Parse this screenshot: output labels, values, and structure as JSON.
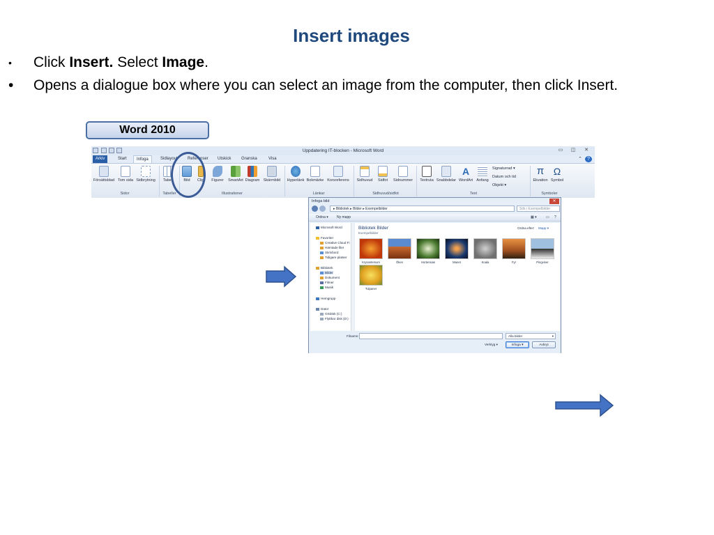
{
  "slide": {
    "title": "Insert images",
    "bullet1": {
      "pre": "Click ",
      "b1": "Insert.",
      "mid": " Select ",
      "b2": "Image",
      "post": "."
    },
    "bullet2": "Opens a dialogue box where you can select an image from the computer, then click Insert.",
    "bullet_glyph": "•",
    "badge": "Word 2010"
  },
  "word": {
    "window_title": "Uppdatering IT-blocken  -  Microsoft Word",
    "window_controls": [
      "▭",
      "◫",
      "✕"
    ],
    "tabs": [
      "Arkiv",
      "Start",
      "Infoga",
      "Sidlayout",
      "Referenser",
      "Utskick",
      "Granska",
      "Visa"
    ],
    "active_tab": "Infoga",
    "buttons": {
      "cover": "Försättsblad",
      "blank": "Tom sida",
      "page_break": "Sidbrytning",
      "table": "Tabell",
      "picture": "Bild",
      "clip": "ClipArt",
      "shapes": "Figurer",
      "smartart": "SmartArt",
      "chart": "Diagram",
      "screenshot": "Skärmbild",
      "hyperlink": "Hyperlänk",
      "bookmark": "Bokmärke",
      "crossref": "Korsreferens",
      "header": "Sidhuvud",
      "footer": "Sidfot",
      "pagenum": "Sidnummer",
      "textbox": "Textruta",
      "quickparts": "Snabbdelar",
      "wordart": "WordArt",
      "dropcap": "Anfang",
      "signature": "Signaturrad",
      "datetime": "Datum och tid",
      "object": "Objekt",
      "equation": "Ekvation",
      "symbol": "Symbol"
    },
    "groups": {
      "pages": "Sidor",
      "tables": "Tabeller",
      "illustrations": "Illustrationer",
      "links": "Länkar",
      "headerfooter": "Sidhuvud/sidfot",
      "text": "Text",
      "symbols": "Symboler"
    }
  },
  "dialog": {
    "title": "Infoga bild",
    "close": "✕",
    "address": "▸ Bibliotek ▸ Bilder ▸ Exempelbilder",
    "search_placeholder": "Sök i Exempelbilder",
    "toolbar": {
      "organize": "Ordna ▾",
      "new_folder": "Ny mapp"
    },
    "nav": {
      "word": "Microsoft Word",
      "favorites": "Favoriter",
      "fav_items": [
        "Creative Cloud Fi",
        "Hämtade filer",
        "Skrivbord",
        "Tidigare platser"
      ],
      "libraries": "Bibliotek",
      "lib_items": [
        "Bilder",
        "Dokument",
        "Filmer",
        "Musik"
      ],
      "homegroup": "Hemgrupp",
      "computer": "Dator",
      "drives": [
        "OSDisk (C:)",
        "Flyttbar disk (D:)"
      ]
    },
    "library_title": "Bibliotek Bilder",
    "library_sub": "Exempelbilder",
    "arrange": "Ordna efter:",
    "arrange_value": "Mapp ▾",
    "images": [
      "Krysantemum",
      "Öken",
      "Hortensias",
      "Manet",
      "Koala",
      "Fyr",
      "Pingviner",
      "Tulpaner"
    ],
    "filename_label": "Filnamn:",
    "filter": "Alla bilder",
    "tools": "Verktyg",
    "insert_btn": "Infoga",
    "cancel_btn": "Avbryt"
  },
  "colors": {
    "title": "#1f497d",
    "arrow_fill": "#4472c4",
    "arrow_stroke": "#2f528f",
    "circle": "#3a5b95"
  }
}
